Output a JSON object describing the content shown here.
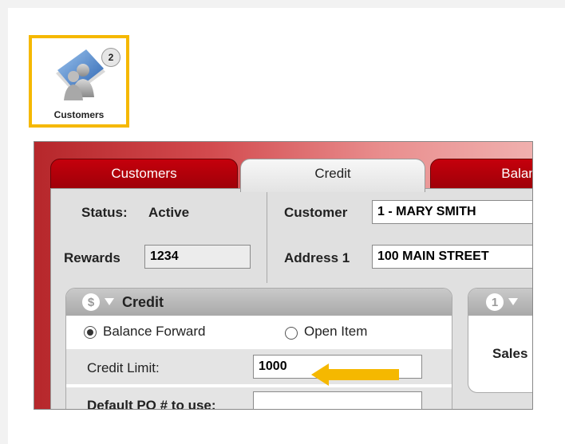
{
  "app_icon": {
    "label": "Customers",
    "badge_count": "2",
    "icon": "customers-people-icon",
    "highlight_color": "#f5b800"
  },
  "tabs": [
    {
      "label": "Customers",
      "active": false
    },
    {
      "label": "Credit",
      "active": true
    },
    {
      "label": "Balance",
      "active": false
    }
  ],
  "header": {
    "status_label": "Status:",
    "status_value": "Active",
    "rewards_label": "Rewards",
    "rewards_value": "1234",
    "customer_label": "Customer",
    "customer_value": "1 - MARY SMITH",
    "address1_label": "Address 1",
    "address1_value": "100 MAIN STREET"
  },
  "credit_section": {
    "icon": "dollar-icon",
    "icon_glyph": "$",
    "title": "Credit",
    "option_balance_forward": "Balance Forward",
    "option_open_item": "Open Item",
    "selected_option": "Balance Forward",
    "credit_limit_label": "Credit Limit:",
    "credit_limit_value": "1000",
    "default_po_label": "Default PO # to use:",
    "default_po_value": ""
  },
  "side_section": {
    "icon_glyph": "1",
    "sales_label": "Sales"
  },
  "colors": {
    "tab_red": "#c5000c",
    "highlight_arrow": "#f5b800"
  }
}
